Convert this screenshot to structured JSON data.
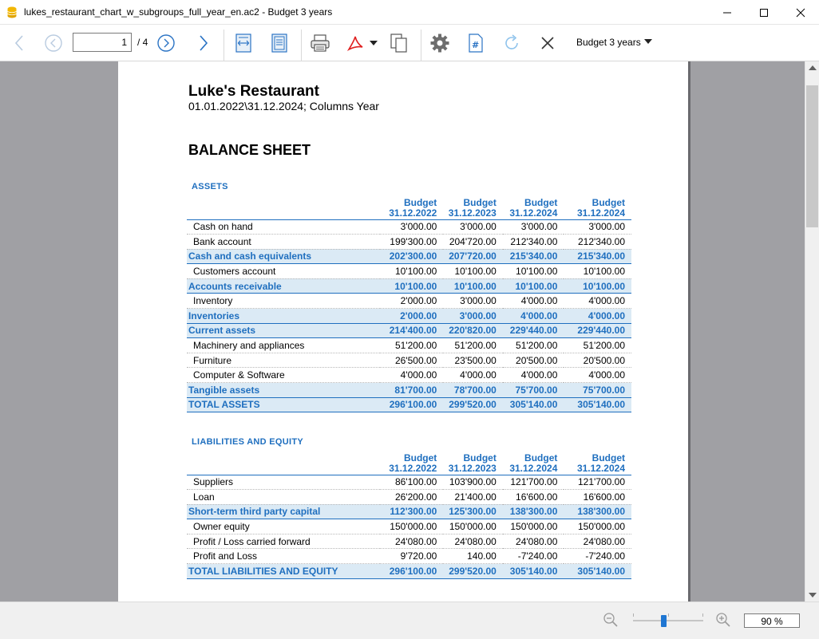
{
  "window": {
    "title": "lukes_restaurant_chart_w_subgroups_full_year_en.ac2 - Budget 3 years"
  },
  "toolbar": {
    "page_current": "1",
    "page_total": "/ 4",
    "budget_select": "Budget 3 years"
  },
  "report": {
    "title": "Luke's Restaurant",
    "subtitle": "01.01.2022\\31.12.2024; Columns Year",
    "heading": "BALANCE SHEET",
    "sections": [
      {
        "label": "ASSETS",
        "columns": [
          {
            "line1": "Budget",
            "line2": "31.12.2022"
          },
          {
            "line1": "Budget",
            "line2": "31.12.2023"
          },
          {
            "line1": "Budget",
            "line2": "31.12.2024"
          },
          {
            "line1": "Budget",
            "line2": "31.12.2024"
          }
        ],
        "rows": [
          {
            "type": "item",
            "label": "Cash on hand",
            "values": [
              "3'000.00",
              "3'000.00",
              "3'000.00",
              "3'000.00"
            ]
          },
          {
            "type": "item",
            "label": "Bank account",
            "values": [
              "199'300.00",
              "204'720.00",
              "212'340.00",
              "212'340.00"
            ]
          },
          {
            "type": "total",
            "label": "Cash and cash equivalents",
            "values": [
              "202'300.00",
              "207'720.00",
              "215'340.00",
              "215'340.00"
            ]
          },
          {
            "type": "item",
            "label": "Customers account",
            "values": [
              "10'100.00",
              "10'100.00",
              "10'100.00",
              "10'100.00"
            ]
          },
          {
            "type": "total",
            "label": "Accounts receivable",
            "values": [
              "10'100.00",
              "10'100.00",
              "10'100.00",
              "10'100.00"
            ]
          },
          {
            "type": "item",
            "label": "Inventory",
            "values": [
              "2'000.00",
              "3'000.00",
              "4'000.00",
              "4'000.00"
            ]
          },
          {
            "type": "total",
            "label": "Inventories",
            "values": [
              "2'000.00",
              "3'000.00",
              "4'000.00",
              "4'000.00"
            ]
          },
          {
            "type": "total",
            "label": "Current assets",
            "values": [
              "214'400.00",
              "220'820.00",
              "229'440.00",
              "229'440.00"
            ]
          },
          {
            "type": "item",
            "label": "Machinery and appliances",
            "values": [
              "51'200.00",
              "51'200.00",
              "51'200.00",
              "51'200.00"
            ]
          },
          {
            "type": "item",
            "label": "Furniture",
            "values": [
              "26'500.00",
              "23'500.00",
              "20'500.00",
              "20'500.00"
            ]
          },
          {
            "type": "item",
            "label": "Computer & Software",
            "values": [
              "4'000.00",
              "4'000.00",
              "4'000.00",
              "4'000.00"
            ]
          },
          {
            "type": "total",
            "label": "Tangible assets",
            "values": [
              "81'700.00",
              "78'700.00",
              "75'700.00",
              "75'700.00"
            ]
          },
          {
            "type": "total",
            "label": "TOTAL ASSETS",
            "values": [
              "296'100.00",
              "299'520.00",
              "305'140.00",
              "305'140.00"
            ]
          }
        ]
      },
      {
        "label": "LIABILITIES AND EQUITY",
        "columns": [
          {
            "line1": "Budget",
            "line2": "31.12.2022"
          },
          {
            "line1": "Budget",
            "line2": "31.12.2023"
          },
          {
            "line1": "Budget",
            "line2": "31.12.2024"
          },
          {
            "line1": "Budget",
            "line2": "31.12.2024"
          }
        ],
        "rows": [
          {
            "type": "item",
            "label": "Suppliers",
            "values": [
              "86'100.00",
              "103'900.00",
              "121'700.00",
              "121'700.00"
            ]
          },
          {
            "type": "item",
            "label": "Loan",
            "values": [
              "26'200.00",
              "21'400.00",
              "16'600.00",
              "16'600.00"
            ]
          },
          {
            "type": "total",
            "label": "Short-term third party capital",
            "values": [
              "112'300.00",
              "125'300.00",
              "138'300.00",
              "138'300.00"
            ]
          },
          {
            "type": "item",
            "label": "Owner equity",
            "values": [
              "150'000.00",
              "150'000.00",
              "150'000.00",
              "150'000.00"
            ]
          },
          {
            "type": "item",
            "label": "Profit / Loss carried forward",
            "values": [
              "24'080.00",
              "24'080.00",
              "24'080.00",
              "24'080.00"
            ]
          },
          {
            "type": "item",
            "label": "Profit and Loss",
            "values": [
              "9'720.00",
              "140.00",
              "-7'240.00",
              "-7'240.00"
            ]
          },
          {
            "type": "total",
            "label": "TOTAL LIABILITIES AND EQUITY",
            "values": [
              "296'100.00",
              "299'520.00",
              "305'140.00",
              "305'140.00"
            ]
          }
        ]
      }
    ]
  },
  "statusbar": {
    "zoom": "90 %",
    "zoom_level_percent": 90
  },
  "colors": {
    "accent": "#1f6fbf",
    "total_row_bg": "#dbeaf5",
    "viewport_bg": "#a0a0a4"
  }
}
